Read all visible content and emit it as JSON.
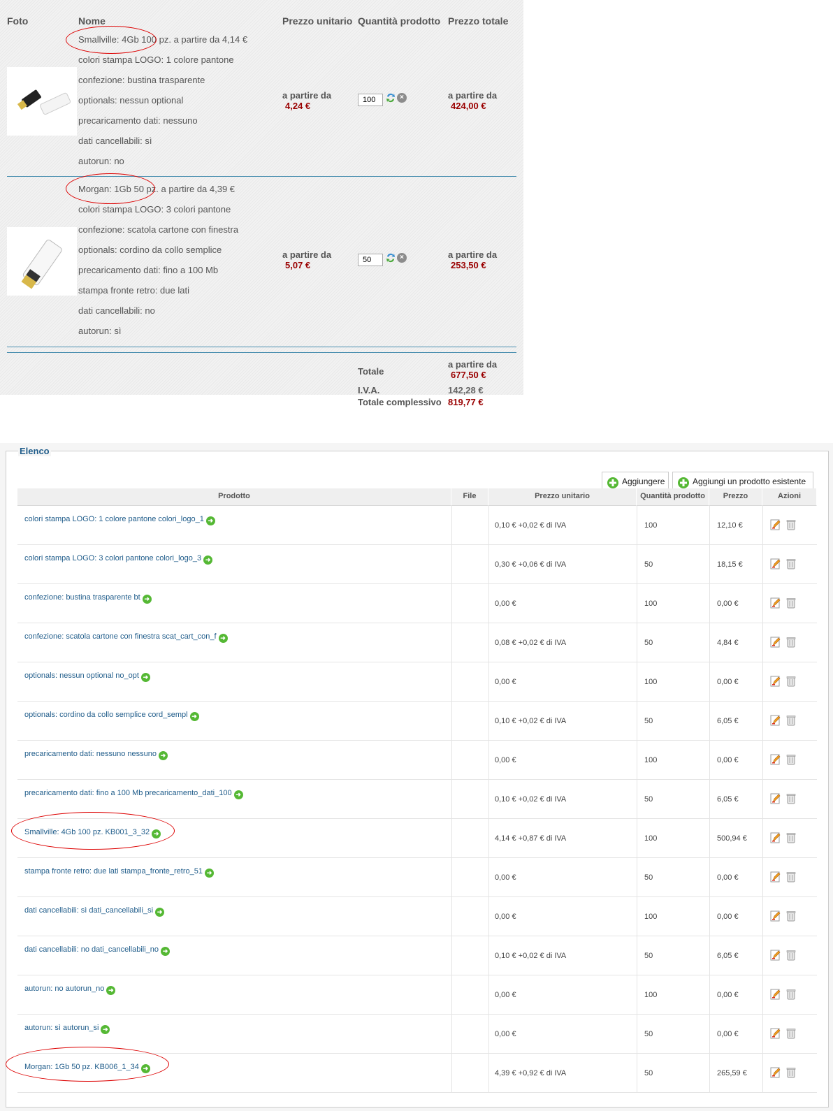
{
  "cart": {
    "headers": {
      "foto": "Foto",
      "nome": "Nome",
      "prezzo_unitario": "Prezzo unitario",
      "quantita": "Quantità prodotto",
      "prezzo_totale": "Prezzo totale"
    },
    "items": [
      {
        "attributes": [
          "Smallville: 4Gb 100 pz. a partire da 4,14 €",
          "colori stampa LOGO: 1 colore pantone",
          "confezione: bustina trasparente",
          "optionals: nessun optional",
          "precaricamento dati: nessuno",
          "dati cancellabili: sì",
          "autorun: no"
        ],
        "unit_label": "a partire da",
        "unit_price": "4,24 €",
        "qty": "100",
        "total_label": "a partire da",
        "total_price": "424,00 €"
      },
      {
        "attributes": [
          "Morgan: 1Gb 50 pz. a partire da 4,39 €",
          "colori stampa LOGO: 3 colori pantone",
          "confezione: scatola cartone con finestra",
          "optionals: cordino da collo semplice",
          "precaricamento dati: fino a 100 Mb",
          "stampa fronte retro: due lati",
          "dati cancellabili: no",
          "autorun: sì"
        ],
        "unit_label": "a partire da",
        "unit_price": "5,07 €",
        "qty": "50",
        "total_label": "a partire da",
        "total_price": "253,50 €"
      }
    ],
    "totals": {
      "totale_label": "Totale",
      "totale_prefix": "a partire da",
      "totale_value": "677,50 €",
      "iva_label": "I.V.A.",
      "iva_value": "142,28 €",
      "complessivo_label": "Totale complessivo",
      "complessivo_value": "819,77 €"
    },
    "accent_color": "#9a0000"
  },
  "elenco": {
    "legend": "Elenco",
    "buttons": {
      "add": "Aggiungere",
      "add_existing": "Aggiungi un prodotto esistente"
    },
    "columns": {
      "prodotto": "Prodotto",
      "file": "File",
      "prezzo_unitario": "Prezzo unitario",
      "quantita": "Quantità prodotto",
      "prezzo": "Prezzo",
      "azioni": "Azioni"
    },
    "rows": [
      {
        "product": "colori stampa LOGO: 1 colore pantone colori_logo_1",
        "unit": "0,10 € +0,02 € di IVA",
        "qty": "100",
        "price": "12,10 €"
      },
      {
        "product": "colori stampa LOGO: 3 colori pantone colori_logo_3",
        "unit": "0,30 € +0,06 € di IVA",
        "qty": "50",
        "price": "18,15 €"
      },
      {
        "product": "confezione: bustina trasparente bt",
        "unit": "0,00 €",
        "qty": "100",
        "price": "0,00 €"
      },
      {
        "product": "confezione: scatola cartone con finestra scat_cart_con_f",
        "unit": "0,08 € +0,02 € di IVA",
        "qty": "50",
        "price": "4,84 €"
      },
      {
        "product": "optionals: nessun optional no_opt",
        "unit": "0,00 €",
        "qty": "100",
        "price": "0,00 €"
      },
      {
        "product": "optionals: cordino da collo semplice cord_sempl",
        "unit": "0,10 € +0,02 € di IVA",
        "qty": "50",
        "price": "6,05 €"
      },
      {
        "product": "precaricamento dati: nessuno nessuno",
        "unit": "0,00 €",
        "qty": "100",
        "price": "0,00 €"
      },
      {
        "product": "precaricamento dati: fino a 100 Mb precaricamento_dati_100",
        "unit": "0,10 € +0,02 € di IVA",
        "qty": "50",
        "price": "6,05 €"
      },
      {
        "product": "Smallville: 4Gb 100 pz. KB001_3_32",
        "unit": "4,14 € +0,87 € di IVA",
        "qty": "100",
        "price": "500,94 €"
      },
      {
        "product": "stampa fronte retro: due lati stampa_fronte_retro_51",
        "unit": "0,00 €",
        "qty": "50",
        "price": "0,00 €"
      },
      {
        "product": "dati cancellabili: sì dati_cancellabili_si",
        "unit": "0,00 €",
        "qty": "100",
        "price": "0,00 €"
      },
      {
        "product": "dati cancellabili: no dati_cancellabili_no",
        "unit": "0,10 € +0,02 € di IVA",
        "qty": "50",
        "price": "6,05 €"
      },
      {
        "product": "autorun: no autorun_no",
        "unit": "0,00 €",
        "qty": "100",
        "price": "0,00 €"
      },
      {
        "product": "autorun: sì autorun_si",
        "unit": "0,00 €",
        "qty": "50",
        "price": "0,00 €"
      },
      {
        "product": "Morgan: 1Gb 50 pz. KB006_1_34",
        "unit": "4,39 € +0,92 € di IVA",
        "qty": "50",
        "price": "265,59 €"
      }
    ],
    "link_color": "#1f5c8a"
  }
}
